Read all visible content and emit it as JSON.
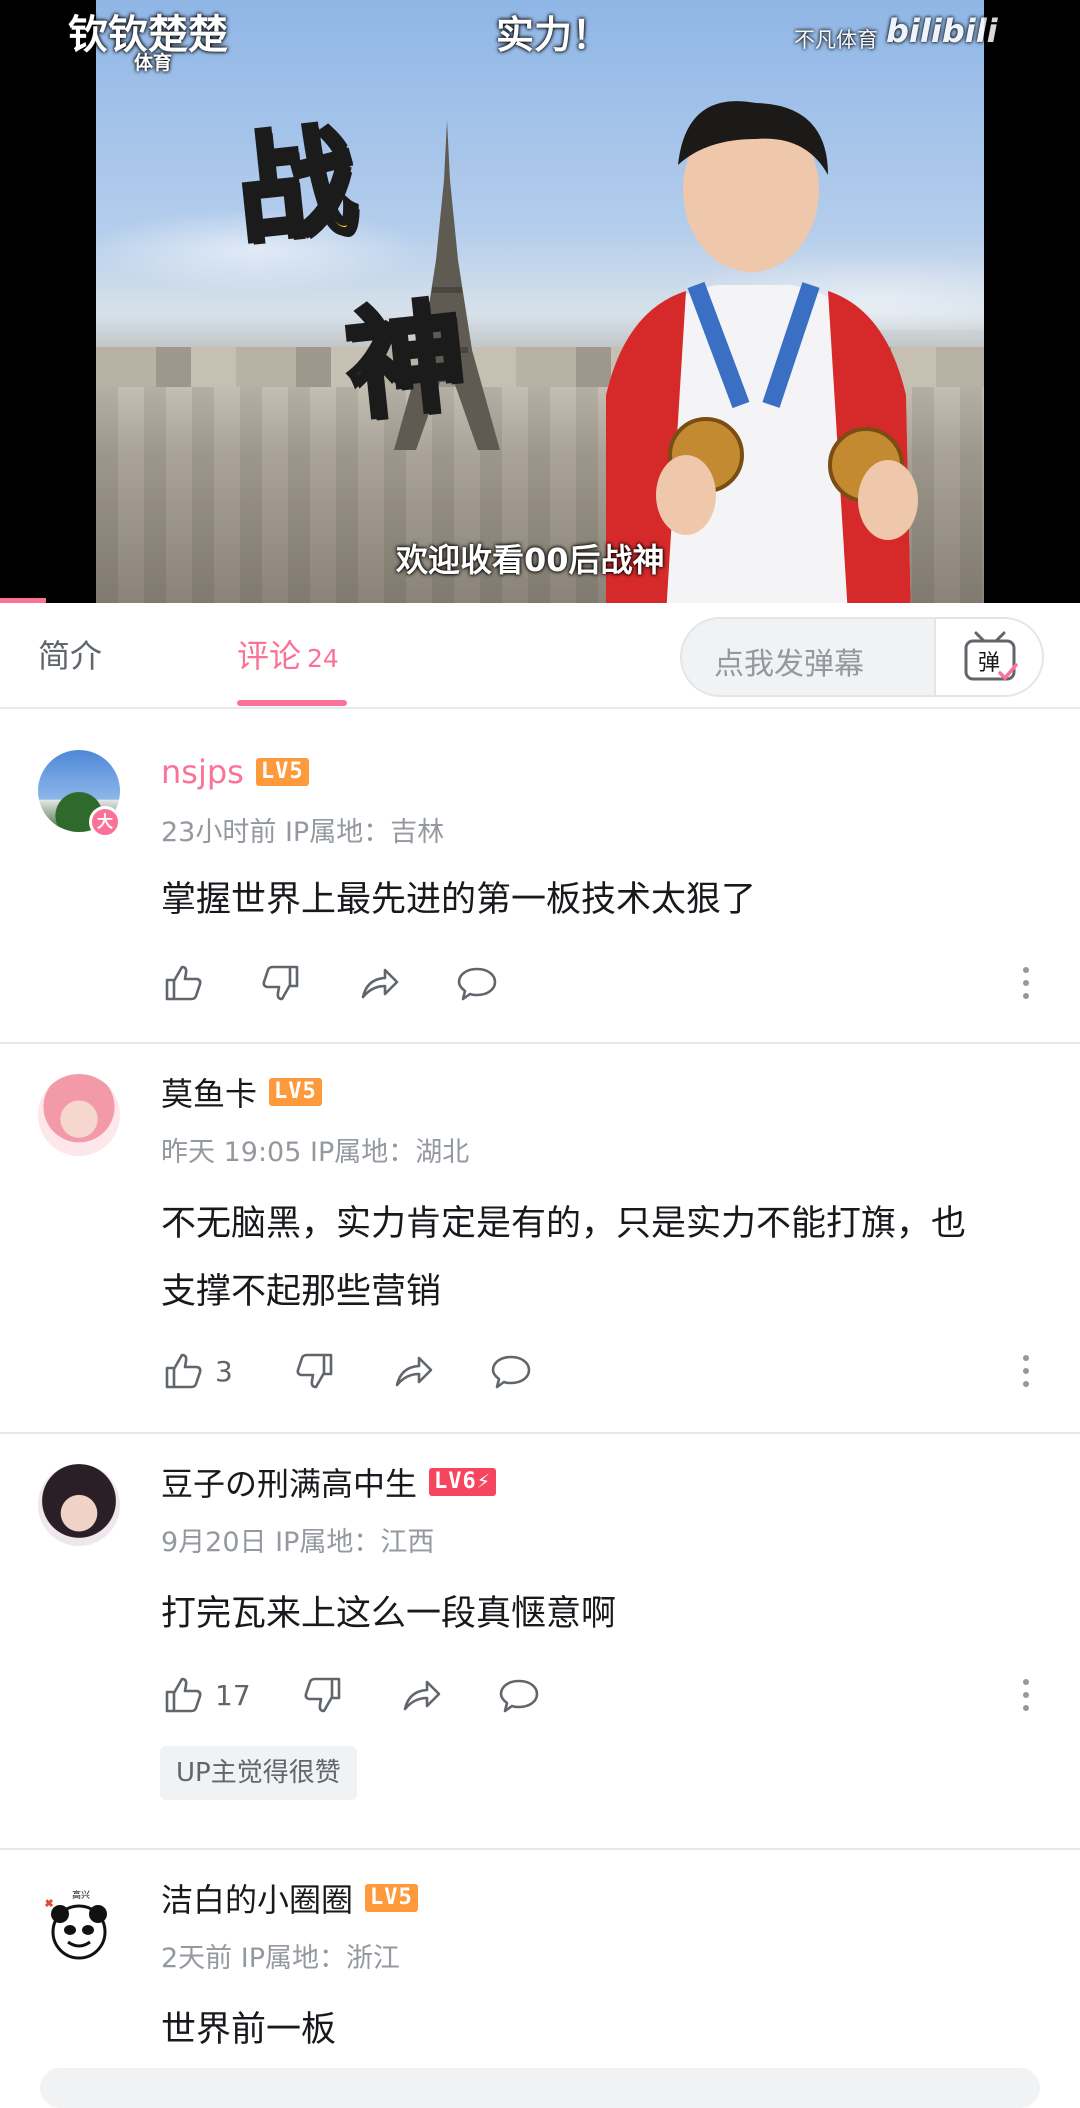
{
  "video": {
    "top_left_title": "钦钦楚楚",
    "top_left_sub": "体育",
    "top_center": "实力！",
    "watermark": "不凡体育",
    "watermark_brand": "bilibili",
    "big_chars": [
      "战",
      "神"
    ],
    "subtitle": "欢迎收看00后战神"
  },
  "tabs": {
    "intro": "简介",
    "comments": "评论",
    "comments_count": "24",
    "danmaku_placeholder": "点我发弹幕",
    "danmaku_icon_char": "弹"
  },
  "comments": [
    {
      "username": "nsjps",
      "level": "LV5",
      "time": "23小时前",
      "ip": "IP属地：吉林",
      "text": "掌握世界上最先进的第一板技术太狠了",
      "likes": "",
      "avatar_badge": "大"
    },
    {
      "username": "莫鱼卡",
      "level": "LV5",
      "time": "昨天 19:05",
      "ip": "IP属地：湖北",
      "text": "不无脑黑，实力肯定是有的，只是实力不能打旗，也支撑不起那些营销",
      "likes": "3"
    },
    {
      "username": "豆子の刑满高中生",
      "level": "LV6",
      "time": "9月20日",
      "ip": "IP属地：江西",
      "text": "打完瓦来上这么一段真惬意啊",
      "likes": "17",
      "up_tag": "UP主觉得很赞"
    },
    {
      "username": "洁白的小圈圈",
      "level": "LV5",
      "time": "2天前",
      "ip": "IP属地：浙江",
      "text": "世界前一板",
      "avatar_caption": "高兴"
    }
  ],
  "colors": {
    "accent": "#fb7299",
    "lv5": "#ff9a3c",
    "lv6": "#f6455f",
    "text_secondary": "#9499a0"
  },
  "icons": [
    "like-icon",
    "dislike-icon",
    "share-icon",
    "reply-icon",
    "more-vertical-icon",
    "danmaku-toggle-icon"
  ]
}
